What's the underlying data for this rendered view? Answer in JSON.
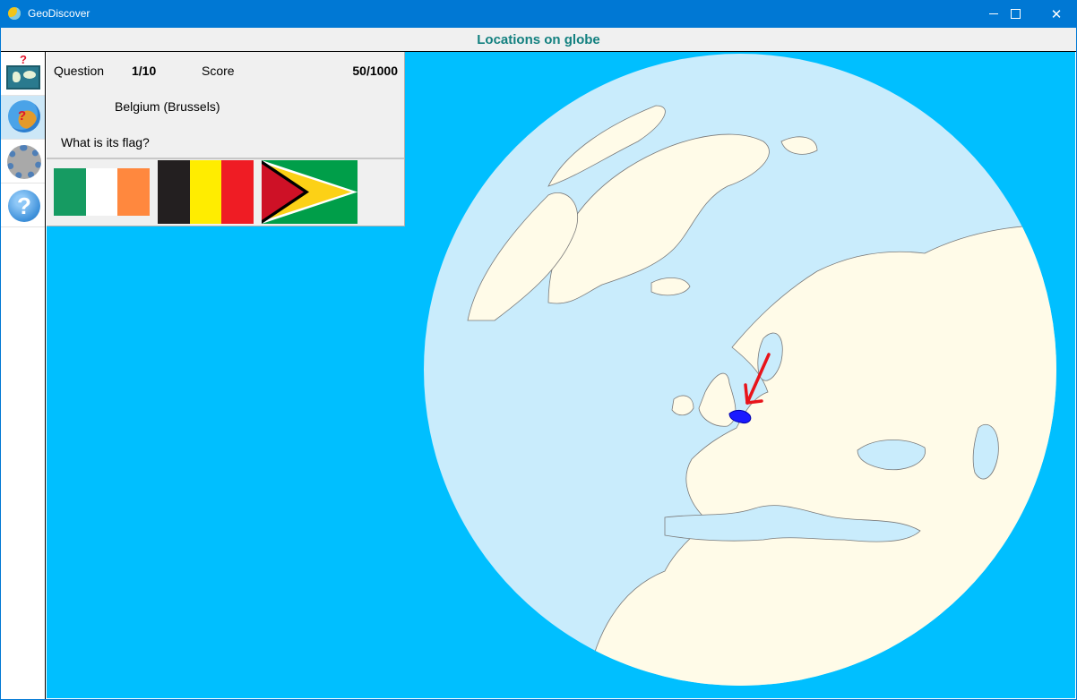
{
  "window": {
    "title": "GeoDiscover",
    "minimize_icon": "minimize-icon",
    "maximize_icon": "maximize-icon",
    "close_icon": "close-icon",
    "close_glyph": "✕"
  },
  "header": {
    "title": "Locations on globe"
  },
  "sidebar": {
    "items": [
      {
        "name": "map-quiz",
        "icon": "world-map-question-icon",
        "badge": "?"
      },
      {
        "name": "globe-quiz",
        "icon": "globe-question-icon",
        "badge": "?",
        "active": true
      },
      {
        "name": "settings",
        "icon": "gear-icon"
      },
      {
        "name": "help",
        "icon": "help-icon",
        "glyph": "?"
      }
    ]
  },
  "quiz": {
    "question_label": "Question",
    "question_value": "1/10",
    "score_label": "Score",
    "score_value": "50/1000",
    "country": "Belgium (Brussels)",
    "prompt": "What is its flag?",
    "flags": [
      {
        "name": "flag-ireland",
        "colors": [
          "#169b62",
          "#ffffff",
          "#ff883e"
        ]
      },
      {
        "name": "flag-belgium",
        "colors": [
          "#231f20",
          "#ffed00",
          "#ef1c24"
        ]
      },
      {
        "name": "flag-guyana",
        "colors": [
          "#009e49",
          "#fcd116",
          "#ce1126",
          "#000000",
          "#ffffff"
        ]
      }
    ]
  },
  "map": {
    "ocean_color": "#00bfff",
    "globe_sea_color": "#c9ecfc",
    "land_color": "#fffbe8",
    "highlight_color": "#1a1aff",
    "arrow_color": "#e8141b",
    "highlighted_country": "Belgium"
  }
}
